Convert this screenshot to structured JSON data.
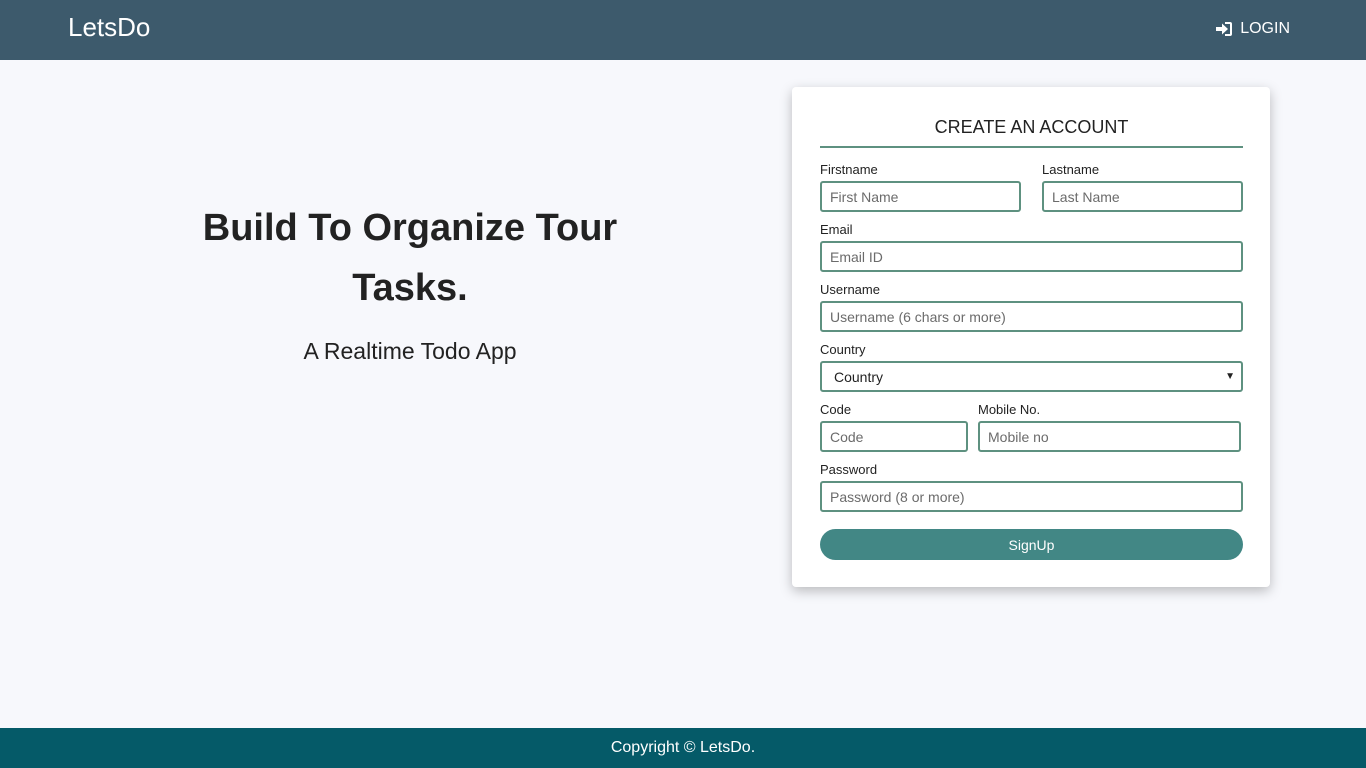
{
  "navbar": {
    "brand": "LetsDo",
    "login_label": "LOGIN",
    "login_icon": "sign-in-icon"
  },
  "hero": {
    "title": "Build To Organize Tour Tasks.",
    "subtitle": "A Realtime Todo App"
  },
  "form": {
    "title": "CREATE AN ACCOUNT",
    "firstname": {
      "label": "Firstname",
      "placeholder": "First Name",
      "value": ""
    },
    "lastname": {
      "label": "Lastname",
      "placeholder": "Last Name",
      "value": ""
    },
    "email": {
      "label": "Email",
      "placeholder": "Email ID",
      "value": ""
    },
    "username": {
      "label": "Username",
      "placeholder": "Username (6 chars or more)",
      "value": ""
    },
    "country": {
      "label": "Country",
      "selected": "Country"
    },
    "code": {
      "label": "Code",
      "placeholder": "Code",
      "value": ""
    },
    "mobile": {
      "label": "Mobile No.",
      "placeholder": "Mobile no",
      "value": ""
    },
    "password": {
      "label": "Password",
      "placeholder": "Password (8 or more)",
      "value": ""
    },
    "submit_label": "SignUp"
  },
  "footer": {
    "copyright": "Copyright © LetsDo."
  },
  "colors": {
    "navbar_bg": "#3d5a6c",
    "accent": "#5e9180",
    "button_bg": "#428785",
    "footer_bg": "#055a68",
    "page_bg": "#f7f8fc"
  }
}
